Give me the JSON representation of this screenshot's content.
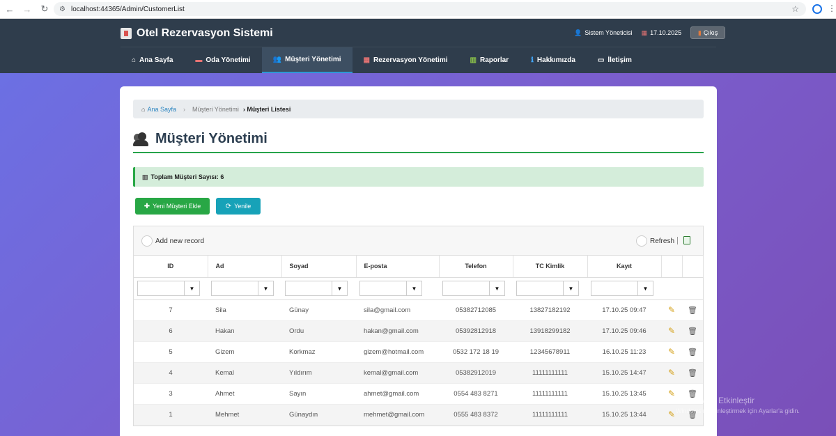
{
  "browser": {
    "url": "localhost:44365/Admin/CustomerList"
  },
  "header": {
    "brand": "Otel Rezervasyon Sistemi",
    "user": "Sistem Yöneticisi",
    "date": "17.10.2025",
    "logout": "Çıkış"
  },
  "menu": [
    {
      "label": "Ana Sayfa",
      "icon": "home-icon"
    },
    {
      "label": "Oda Yönetimi",
      "icon": "bed-icon"
    },
    {
      "label": "Müşteri Yönetimi",
      "icon": "users-icon",
      "active": true
    },
    {
      "label": "Rezervasyon Yönetimi",
      "icon": "calendar-icon"
    },
    {
      "label": "Raporlar",
      "icon": "chart-icon"
    },
    {
      "label": "Hakkımızda",
      "icon": "info-icon"
    },
    {
      "label": "İletişim",
      "icon": "contact-icon"
    }
  ],
  "breadcrumb": {
    "home": "Ana Sayfa",
    "mid": "Müşteri Yönetimi",
    "current": "› Müşteri Listesi"
  },
  "page": {
    "title": "Müşteri Yönetimi",
    "total_label": "Toplam Müşteri Sayısı: 6",
    "add_button": "Yeni Müşteri Ekle",
    "refresh_button": "Yenile"
  },
  "grid": {
    "add_record": "Add new record",
    "refresh": "Refresh",
    "columns": [
      "ID",
      "Ad",
      "Soyad",
      "E-posta",
      "Telefon",
      "TC Kimlik",
      "Kayıt"
    ],
    "rows": [
      [
        "7",
        "Sila",
        "Günay",
        "sila@gmail.com",
        "05382712085",
        "13827182192",
        "17.10.25 09:47"
      ],
      [
        "6",
        "Hakan",
        "Ordu",
        "hakan@gmail.com",
        "05392812918",
        "13918299182",
        "17.10.25 09:46"
      ],
      [
        "5",
        "Gizem",
        "Korkmaz",
        "gizem@hotmail.com",
        "0532 172 18 19",
        "12345678911",
        "16.10.25 11:23"
      ],
      [
        "4",
        "Kemal",
        "Yıldırım",
        "kemal@gmail.com",
        "05382912019",
        "11111111111",
        "15.10.25 14:47"
      ],
      [
        "3",
        "Ahmet",
        "Sayın",
        "ahmet@gmail.com",
        "0554 483 8271",
        "11111111111",
        "15.10.25 13:45"
      ],
      [
        "1",
        "Mehmet",
        "Günaydın",
        "mehmet@gmail.com",
        "0555 483 8372",
        "11111111111",
        "15.10.25 13:44"
      ]
    ]
  },
  "watermark": {
    "line1": "Windows'u Etkinleştir",
    "line2": "Windows'u etkinleştirmek için Ayarlar'a gidin."
  },
  "colors": {
    "header": "#2f3d4c",
    "accent_green": "#28a745",
    "accent_teal": "#17a2b8",
    "link": "#2e86c1"
  }
}
